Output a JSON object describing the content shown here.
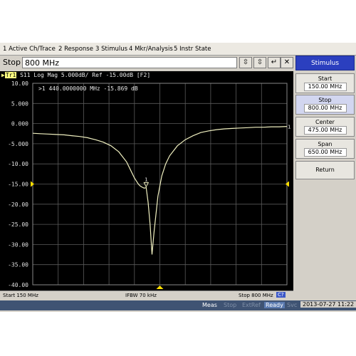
{
  "menu": {
    "active_ch_trace": "1 Active Ch/Trace",
    "response": "2 Response",
    "stimulus": "3 Stimulus",
    "mkr_analysis": "4 Mkr/Analysis",
    "instr_state": "5 Instr State"
  },
  "entry": {
    "label": "Stop",
    "value": "800 MHz"
  },
  "trace": {
    "id": "Tr1",
    "header": "S11 Log Mag 5.000dB/ Ref -15.00dB [F2]",
    "marker_readout": ">1  440.0000000 MHz -15.869 dB",
    "marker_number": "1",
    "end_label": "1",
    "color": "#f0f0c0"
  },
  "axis": {
    "y_ticks": [
      "10.00",
      "5.000",
      "0.000",
      "-5.000",
      "-10.00",
      "-15.00",
      "-20.00",
      "-25.00",
      "-30.00",
      "-35.00",
      "-40.00"
    ]
  },
  "status": {
    "start": "Start 150 MHz",
    "ifbw": "IFBW 70 kHz",
    "stop": "Stop 800 MHz",
    "channel": "C?"
  },
  "softkeys": {
    "title": "Stimulus",
    "start_label": "Start",
    "start_value": "150.00 MHz",
    "stop_label": "Stop",
    "stop_value": "800.00 MHz",
    "center_label": "Center",
    "center_value": "475.00 MHz",
    "span_label": "Span",
    "span_value": "650.00 MHz",
    "return_label": "Return"
  },
  "bottom": {
    "meas": "Meas",
    "stop": "Stop",
    "extref": "ExtRef",
    "ready": "Ready",
    "svc": "Svc",
    "datetime": "2013-07-27 11:22"
  },
  "chart_data": {
    "type": "line",
    "xlim": [
      150,
      800
    ],
    "ylim": [
      -40,
      10
    ],
    "grid": true,
    "x": [
      150,
      170,
      190,
      210,
      230,
      250,
      270,
      290,
      310,
      330,
      350,
      370,
      390,
      400,
      410,
      420,
      425,
      430,
      435,
      440,
      445,
      450,
      455,
      460,
      470,
      480,
      490,
      500,
      520,
      540,
      560,
      580,
      600,
      620,
      640,
      660,
      680,
      700,
      720,
      740,
      760,
      780,
      800
    ],
    "values": [
      -2.4,
      -2.5,
      -2.6,
      -2.7,
      -2.8,
      -3.0,
      -3.2,
      -3.5,
      -4.0,
      -4.6,
      -5.5,
      -7.0,
      -9.5,
      -11.5,
      -13.5,
      -15.0,
      -15.5,
      -15.8,
      -16.0,
      -15.9,
      -19.5,
      -25.0,
      -32.5,
      -27.0,
      -18.0,
      -13.0,
      -10.0,
      -8.0,
      -5.5,
      -4.0,
      -3.0,
      -2.2,
      -1.8,
      -1.5,
      -1.3,
      -1.2,
      -1.1,
      -1.0,
      -0.9,
      -0.9,
      -0.8,
      -0.8,
      -0.7
    ]
  }
}
